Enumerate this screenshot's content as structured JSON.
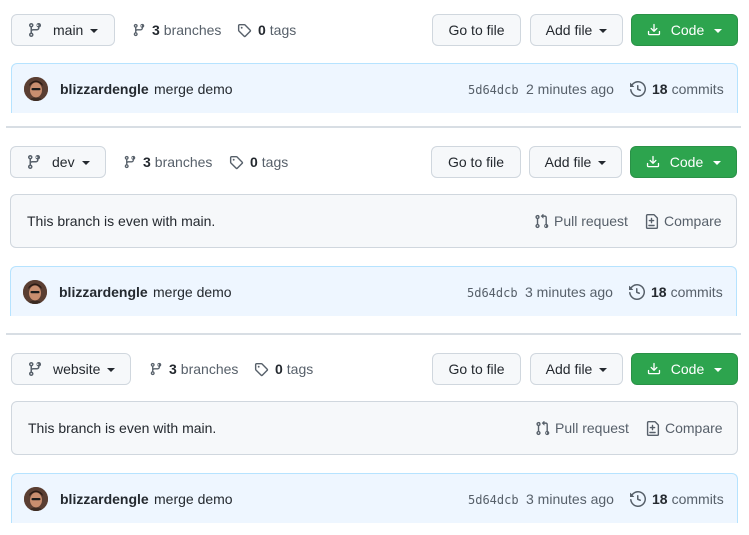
{
  "panels": [
    {
      "branch": "main",
      "branches_count": "3",
      "branches_label": "branches",
      "tags_count": "0",
      "tags_label": "tags",
      "go_to_file": "Go to file",
      "add_file": "Add file",
      "code": "Code",
      "even_text": null,
      "commit": {
        "author": "blizzardengle",
        "message": "merge demo",
        "sha": "5d64dcb",
        "ago": "2 minutes ago",
        "commits_count": "18",
        "commits_label": "commits"
      }
    },
    {
      "branch": "dev",
      "branches_count": "3",
      "branches_label": "branches",
      "tags_count": "0",
      "tags_label": "tags",
      "go_to_file": "Go to file",
      "add_file": "Add file",
      "code": "Code",
      "even_text": "This branch is even with main.",
      "pull_request": "Pull request",
      "compare": "Compare",
      "commit": {
        "author": "blizzardengle",
        "message": "merge demo",
        "sha": "5d64dcb",
        "ago": "3 minutes ago",
        "commits_count": "18",
        "commits_label": "commits"
      }
    },
    {
      "branch": "website",
      "branches_count": "3",
      "branches_label": "branches",
      "tags_count": "0",
      "tags_label": "tags",
      "go_to_file": "Go to file",
      "add_file": "Add file",
      "code": "Code",
      "even_text": "This branch is even with main.",
      "pull_request": "Pull request",
      "compare": "Compare",
      "commit": {
        "author": "blizzardengle",
        "message": "merge demo",
        "sha": "5d64dcb",
        "ago": "3 minutes ago",
        "commits_count": "18",
        "commits_label": "commits"
      }
    }
  ],
  "colors": {
    "green": "#2da44e",
    "commit_bg": "#eef6ff",
    "muted": "#57606a"
  },
  "icons": [
    "git-branch-icon",
    "tag-icon",
    "download-icon",
    "history-icon",
    "pull-request-icon",
    "compare-icon",
    "avatar"
  ]
}
